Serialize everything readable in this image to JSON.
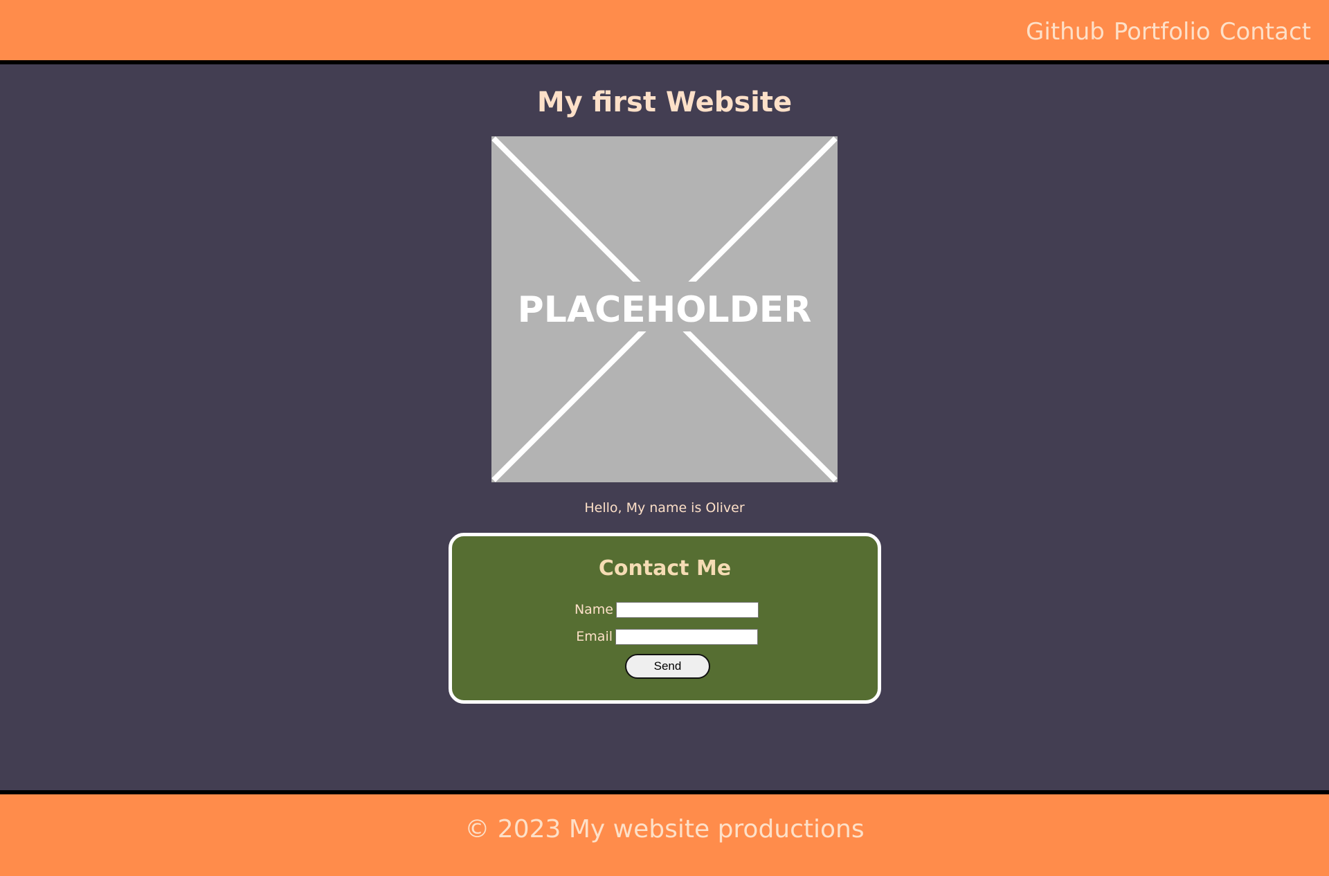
{
  "header": {
    "nav": [
      {
        "label": "Github"
      },
      {
        "label": "Portfolio"
      },
      {
        "label": "Contact"
      }
    ]
  },
  "main": {
    "title": "My first Website",
    "image": {
      "label": "PLACEHOLDER"
    },
    "intro": "Hello, My name is Oliver"
  },
  "contact": {
    "title": "Contact Me",
    "fields": [
      {
        "label": "Name",
        "value": ""
      },
      {
        "label": "Email",
        "value": ""
      }
    ],
    "send_label": "Send"
  },
  "footer": {
    "text": "© 2023 My website productions"
  },
  "colors": {
    "header_bg": "#ff8c4b",
    "page_bg": "#433e52",
    "card_bg": "#566e32",
    "text": "#fde0c8"
  }
}
